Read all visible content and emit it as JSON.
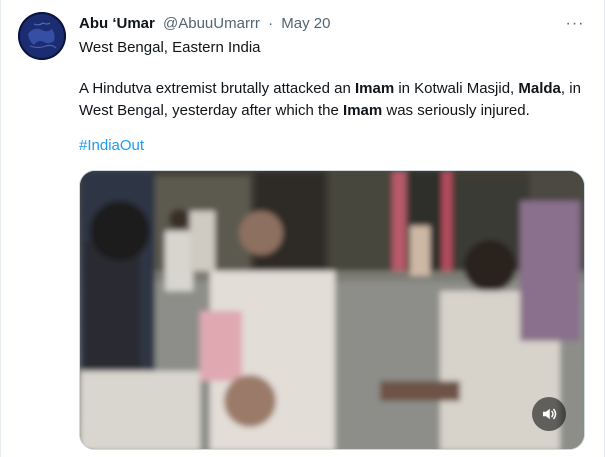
{
  "author": {
    "name": "Abu ‘Umar",
    "handle": "@AbuuUmarrr",
    "separator": "·",
    "date": "May 20"
  },
  "location_line": "West Bengal, Eastern India",
  "tweet_text": {
    "part1": "A Hindutva extremist brutally attacked an ",
    "bold1": "Imam",
    "part2": " in Kotwali Masjid, ",
    "bold2": "Malda",
    "part3": ", in West Bengal, yesterday after which the ",
    "bold3": "Imam",
    "part4": " was seriously injured."
  },
  "hashtag": "#IndiaOut",
  "icons": {
    "more": "more-horizontal-icon",
    "avatar": "globe-avatar",
    "volume": "volume-icon"
  },
  "colors": {
    "link": "#1d9bf0",
    "secondary_text": "#536471",
    "primary_text": "#0f1419"
  }
}
